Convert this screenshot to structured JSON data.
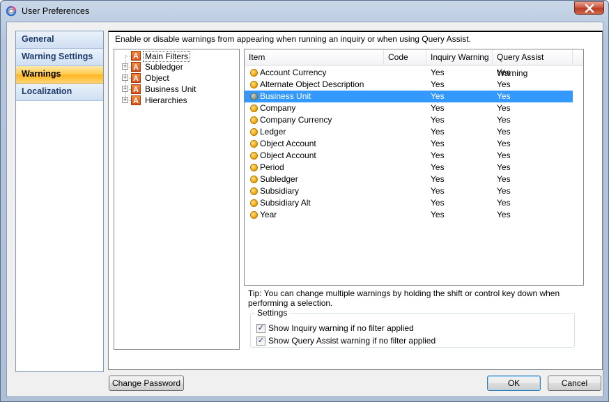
{
  "window": {
    "title": "User Preferences"
  },
  "nav": {
    "items": [
      {
        "label": "General",
        "active": false
      },
      {
        "label": "Warning Settings",
        "active": false
      },
      {
        "label": "Warnings",
        "active": true
      },
      {
        "label": "Localization",
        "active": false
      }
    ]
  },
  "main": {
    "description": "Enable or disable warnings from appearing when running an inquiry or when using Query Assist.",
    "tree": [
      {
        "label": "Main Filters",
        "expandable": false,
        "selected": true,
        "icon": "letter-a-icon",
        "icon_glyph": "A"
      },
      {
        "label": "Subledger",
        "expandable": true,
        "selected": false,
        "icon": "letter-a-icon",
        "icon_glyph": "A"
      },
      {
        "label": "Object",
        "expandable": true,
        "selected": false,
        "icon": "letter-a-icon",
        "icon_glyph": "A"
      },
      {
        "label": "Business Unit",
        "expandable": true,
        "selected": false,
        "icon": "letter-a-icon",
        "icon_glyph": "A"
      },
      {
        "label": "Hierarchies",
        "expandable": true,
        "selected": false,
        "icon": "letter-a-icon",
        "icon_glyph": "A"
      }
    ],
    "grid": {
      "columns": [
        "Item",
        "Code",
        "Inquiry Warning",
        "Query Assist Warning"
      ],
      "rows": [
        {
          "item": "Account Currency",
          "code": "",
          "inquiry": "Yes",
          "query_assist": "Yes",
          "status": "yellow"
        },
        {
          "item": "Alternate Object Description",
          "code": "",
          "inquiry": "Yes",
          "query_assist": "Yes",
          "status": "yellow"
        },
        {
          "item": "Business Unit",
          "code": "",
          "inquiry": "Yes",
          "query_assist": "Yes",
          "status": "grey",
          "selected": true
        },
        {
          "item": "Company",
          "code": "",
          "inquiry": "Yes",
          "query_assist": "Yes",
          "status": "yellow"
        },
        {
          "item": "Company Currency",
          "code": "",
          "inquiry": "Yes",
          "query_assist": "Yes",
          "status": "yellow"
        },
        {
          "item": "Ledger",
          "code": "",
          "inquiry": "Yes",
          "query_assist": "Yes",
          "status": "yellow"
        },
        {
          "item": "Object Account",
          "code": "",
          "inquiry": "Yes",
          "query_assist": "Yes",
          "status": "yellow"
        },
        {
          "item": "Object Account",
          "code": "",
          "inquiry": "Yes",
          "query_assist": "Yes",
          "status": "yellow"
        },
        {
          "item": "Period",
          "code": "",
          "inquiry": "Yes",
          "query_assist": "Yes",
          "status": "yellow"
        },
        {
          "item": "Subledger",
          "code": "",
          "inquiry": "Yes",
          "query_assist": "Yes",
          "status": "yellow"
        },
        {
          "item": "Subsidiary",
          "code": "",
          "inquiry": "Yes",
          "query_assist": "Yes",
          "status": "yellow"
        },
        {
          "item": "Subsidiary Alt",
          "code": "",
          "inquiry": "Yes",
          "query_assist": "Yes",
          "status": "yellow"
        },
        {
          "item": "Year",
          "code": "",
          "inquiry": "Yes",
          "query_assist": "Yes",
          "status": "yellow"
        }
      ]
    },
    "tip": "Tip: You can change multiple warnings by holding the shift or control key down when performing a selection.",
    "settings": {
      "legend": "Settings",
      "options": [
        {
          "label": "Show Inquiry warning if no filter applied",
          "checked": true
        },
        {
          "label": "Show Query Assist warning if no filter applied",
          "checked": true
        }
      ]
    }
  },
  "buttons": {
    "change_password": "Change Password",
    "ok": "OK",
    "cancel": "Cancel"
  },
  "colors": {
    "selection": "#3399ff",
    "nav_active": "#ffc94a",
    "status_yellow": "#f2a90f",
    "status_grey": "#8b9a8b"
  }
}
